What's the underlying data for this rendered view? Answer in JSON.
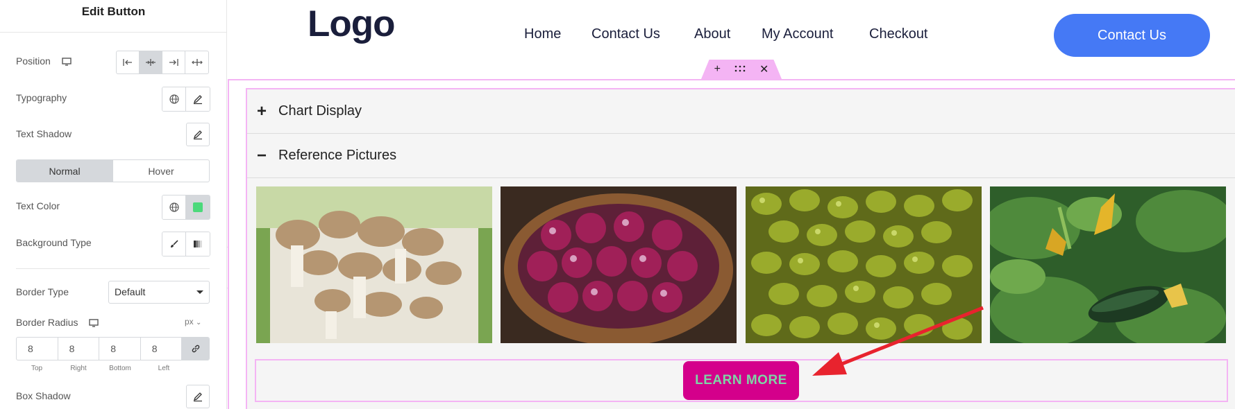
{
  "panel": {
    "title": "Edit Button",
    "position_label": "Position",
    "typography_label": "Typography",
    "text_shadow_label": "Text Shadow",
    "tabs": [
      {
        "label": "Normal"
      },
      {
        "label": "Hover"
      }
    ],
    "text_color_label": "Text Color",
    "background_type_label": "Background Type",
    "border_type_label": "Border Type",
    "border_type_value": "Default",
    "border_radius_label": "Border Radius",
    "border_radius_unit": "px",
    "border_radius": {
      "top": "8",
      "right": "8",
      "bottom": "8",
      "left": "8",
      "labels": {
        "top": "Top",
        "right": "Right",
        "bottom": "Bottom",
        "left": "Left"
      }
    },
    "box_shadow_label": "Box Shadow",
    "text_color_swatch": "#4cd97b"
  },
  "site": {
    "logo": "Logo",
    "nav": [
      {
        "label": "Home"
      },
      {
        "label": "Contact Us"
      },
      {
        "label": "About"
      },
      {
        "label": "My Account"
      },
      {
        "label": "Checkout"
      }
    ],
    "cta_label": "Contact Us",
    "accordion": [
      {
        "symbol": "+",
        "label": "Chart Display"
      },
      {
        "symbol": "−",
        "label": "Reference Pictures"
      }
    ],
    "images": [
      {
        "subject": "mushrooms"
      },
      {
        "subject": "red onions"
      },
      {
        "subject": "green olives"
      },
      {
        "subject": "zucchini plant"
      }
    ],
    "learn_more_label": "LEARN MORE"
  },
  "colors": {
    "accent": "#4579f5",
    "editor_highlight": "#f4b4f4",
    "button_bg": "#d4008b",
    "button_text": "#7ed6a6",
    "arrow": "#e8232e"
  }
}
